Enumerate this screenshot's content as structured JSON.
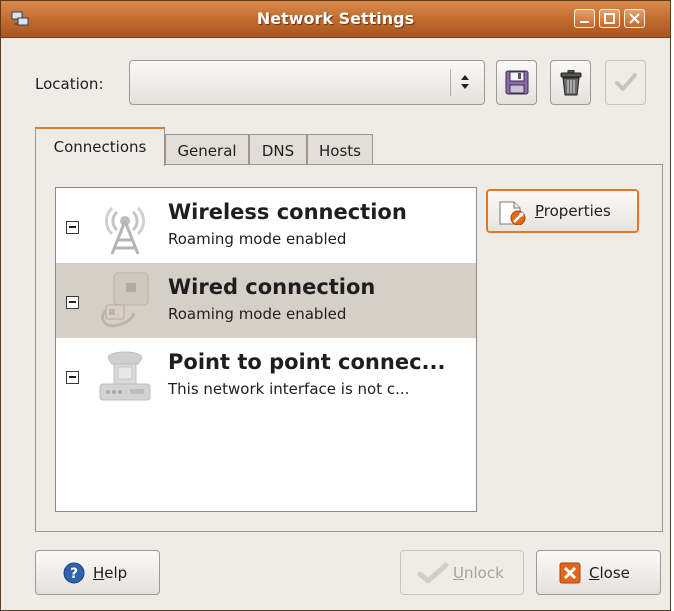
{
  "window": {
    "title": "Network Settings",
    "controls": [
      "minimize",
      "maximize",
      "close"
    ]
  },
  "location": {
    "label": "Location:",
    "value": ""
  },
  "toolbar": {
    "icons": [
      "save-icon",
      "trash-icon",
      "checkmark-icon"
    ]
  },
  "tabs": [
    {
      "label": "Connections",
      "active": true
    },
    {
      "label": "General",
      "active": false
    },
    {
      "label": "DNS",
      "active": false
    },
    {
      "label": "Hosts",
      "active": false
    }
  ],
  "connections": [
    {
      "name": "Wireless connection",
      "status": "Roaming mode enabled",
      "icon": "wireless-antenna-icon",
      "selected": false
    },
    {
      "name": "Wired connection",
      "status": "Roaming mode enabled",
      "icon": "ethernet-icon",
      "selected": true
    },
    {
      "name": "Point to point connec...",
      "status": "This network interface is not c...",
      "icon": "telephone-modem-icon",
      "selected": false
    }
  ],
  "buttons": {
    "properties": {
      "mnemonic": "P",
      "rest": "roperties"
    },
    "help": {
      "mnemonic": "H",
      "rest": "elp"
    },
    "unlock": {
      "mnemonic": "U",
      "rest": "nlock"
    },
    "close": {
      "mnemonic": "C",
      "rest": "lose"
    }
  },
  "colors": {
    "titlebar": "#c06a2d",
    "focus_accent": "#e07a2c",
    "selection": "#d6cfc7",
    "window_bg": "#efebe7"
  }
}
